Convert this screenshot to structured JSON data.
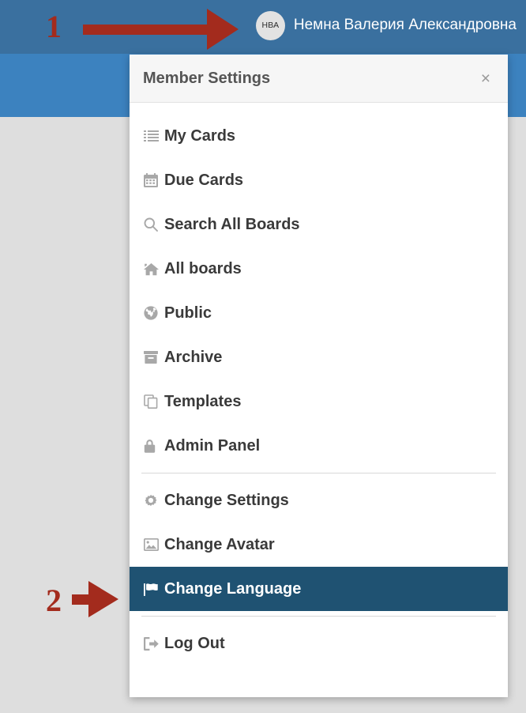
{
  "topbar": {
    "user_initials": "НВА",
    "user_name": "Немна Валерия Александровна",
    "bg_color": "#3a709f"
  },
  "annotations": [
    {
      "label": "1",
      "target": "user-avatar",
      "color": "#a32b1d"
    },
    {
      "label": "2",
      "target": "change-language-menu-item",
      "color": "#a32b1d"
    }
  ],
  "panel": {
    "title": "Member Settings",
    "close_label": "×",
    "highlight_color": "#1f5272",
    "items": [
      {
        "label": "My Cards",
        "icon": "list-icon",
        "active": false
      },
      {
        "label": "Due Cards",
        "icon": "calendar-icon",
        "active": false
      },
      {
        "label": "Search All Boards",
        "icon": "search-icon",
        "active": false
      },
      {
        "label": "All boards",
        "icon": "home-icon",
        "active": false
      },
      {
        "label": "Public",
        "icon": "globe-icon",
        "active": false
      },
      {
        "label": "Archive",
        "icon": "archive-icon",
        "active": false
      },
      {
        "label": "Templates",
        "icon": "copy-icon",
        "active": false
      },
      {
        "label": "Admin Panel",
        "icon": "lock-icon",
        "active": false
      },
      {
        "label": "Change Settings",
        "icon": "gear-icon",
        "active": false
      },
      {
        "label": "Change Avatar",
        "icon": "image-icon",
        "active": false
      },
      {
        "label": "Change Language",
        "icon": "flag-icon",
        "active": true
      },
      {
        "label": "Log Out",
        "icon": "sign-out-icon",
        "active": false
      }
    ]
  }
}
